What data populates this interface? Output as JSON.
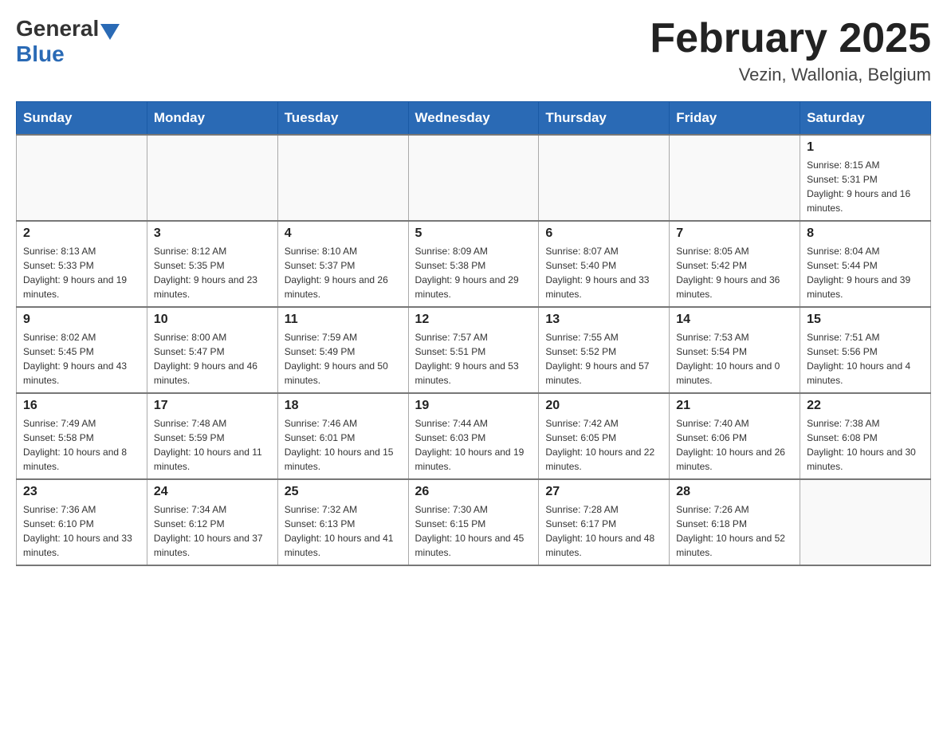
{
  "header": {
    "logo_general": "General",
    "logo_blue": "Blue",
    "month_title": "February 2025",
    "location": "Vezin, Wallonia, Belgium"
  },
  "weekdays": [
    "Sunday",
    "Monday",
    "Tuesday",
    "Wednesday",
    "Thursday",
    "Friday",
    "Saturday"
  ],
  "weeks": [
    [
      {
        "day": "",
        "sunrise": "",
        "sunset": "",
        "daylight": ""
      },
      {
        "day": "",
        "sunrise": "",
        "sunset": "",
        "daylight": ""
      },
      {
        "day": "",
        "sunrise": "",
        "sunset": "",
        "daylight": ""
      },
      {
        "day": "",
        "sunrise": "",
        "sunset": "",
        "daylight": ""
      },
      {
        "day": "",
        "sunrise": "",
        "sunset": "",
        "daylight": ""
      },
      {
        "day": "",
        "sunrise": "",
        "sunset": "",
        "daylight": ""
      },
      {
        "day": "1",
        "sunrise": "Sunrise: 8:15 AM",
        "sunset": "Sunset: 5:31 PM",
        "daylight": "Daylight: 9 hours and 16 minutes."
      }
    ],
    [
      {
        "day": "2",
        "sunrise": "Sunrise: 8:13 AM",
        "sunset": "Sunset: 5:33 PM",
        "daylight": "Daylight: 9 hours and 19 minutes."
      },
      {
        "day": "3",
        "sunrise": "Sunrise: 8:12 AM",
        "sunset": "Sunset: 5:35 PM",
        "daylight": "Daylight: 9 hours and 23 minutes."
      },
      {
        "day": "4",
        "sunrise": "Sunrise: 8:10 AM",
        "sunset": "Sunset: 5:37 PM",
        "daylight": "Daylight: 9 hours and 26 minutes."
      },
      {
        "day": "5",
        "sunrise": "Sunrise: 8:09 AM",
        "sunset": "Sunset: 5:38 PM",
        "daylight": "Daylight: 9 hours and 29 minutes."
      },
      {
        "day": "6",
        "sunrise": "Sunrise: 8:07 AM",
        "sunset": "Sunset: 5:40 PM",
        "daylight": "Daylight: 9 hours and 33 minutes."
      },
      {
        "day": "7",
        "sunrise": "Sunrise: 8:05 AM",
        "sunset": "Sunset: 5:42 PM",
        "daylight": "Daylight: 9 hours and 36 minutes."
      },
      {
        "day": "8",
        "sunrise": "Sunrise: 8:04 AM",
        "sunset": "Sunset: 5:44 PM",
        "daylight": "Daylight: 9 hours and 39 minutes."
      }
    ],
    [
      {
        "day": "9",
        "sunrise": "Sunrise: 8:02 AM",
        "sunset": "Sunset: 5:45 PM",
        "daylight": "Daylight: 9 hours and 43 minutes."
      },
      {
        "day": "10",
        "sunrise": "Sunrise: 8:00 AM",
        "sunset": "Sunset: 5:47 PM",
        "daylight": "Daylight: 9 hours and 46 minutes."
      },
      {
        "day": "11",
        "sunrise": "Sunrise: 7:59 AM",
        "sunset": "Sunset: 5:49 PM",
        "daylight": "Daylight: 9 hours and 50 minutes."
      },
      {
        "day": "12",
        "sunrise": "Sunrise: 7:57 AM",
        "sunset": "Sunset: 5:51 PM",
        "daylight": "Daylight: 9 hours and 53 minutes."
      },
      {
        "day": "13",
        "sunrise": "Sunrise: 7:55 AM",
        "sunset": "Sunset: 5:52 PM",
        "daylight": "Daylight: 9 hours and 57 minutes."
      },
      {
        "day": "14",
        "sunrise": "Sunrise: 7:53 AM",
        "sunset": "Sunset: 5:54 PM",
        "daylight": "Daylight: 10 hours and 0 minutes."
      },
      {
        "day": "15",
        "sunrise": "Sunrise: 7:51 AM",
        "sunset": "Sunset: 5:56 PM",
        "daylight": "Daylight: 10 hours and 4 minutes."
      }
    ],
    [
      {
        "day": "16",
        "sunrise": "Sunrise: 7:49 AM",
        "sunset": "Sunset: 5:58 PM",
        "daylight": "Daylight: 10 hours and 8 minutes."
      },
      {
        "day": "17",
        "sunrise": "Sunrise: 7:48 AM",
        "sunset": "Sunset: 5:59 PM",
        "daylight": "Daylight: 10 hours and 11 minutes."
      },
      {
        "day": "18",
        "sunrise": "Sunrise: 7:46 AM",
        "sunset": "Sunset: 6:01 PM",
        "daylight": "Daylight: 10 hours and 15 minutes."
      },
      {
        "day": "19",
        "sunrise": "Sunrise: 7:44 AM",
        "sunset": "Sunset: 6:03 PM",
        "daylight": "Daylight: 10 hours and 19 minutes."
      },
      {
        "day": "20",
        "sunrise": "Sunrise: 7:42 AM",
        "sunset": "Sunset: 6:05 PM",
        "daylight": "Daylight: 10 hours and 22 minutes."
      },
      {
        "day": "21",
        "sunrise": "Sunrise: 7:40 AM",
        "sunset": "Sunset: 6:06 PM",
        "daylight": "Daylight: 10 hours and 26 minutes."
      },
      {
        "day": "22",
        "sunrise": "Sunrise: 7:38 AM",
        "sunset": "Sunset: 6:08 PM",
        "daylight": "Daylight: 10 hours and 30 minutes."
      }
    ],
    [
      {
        "day": "23",
        "sunrise": "Sunrise: 7:36 AM",
        "sunset": "Sunset: 6:10 PM",
        "daylight": "Daylight: 10 hours and 33 minutes."
      },
      {
        "day": "24",
        "sunrise": "Sunrise: 7:34 AM",
        "sunset": "Sunset: 6:12 PM",
        "daylight": "Daylight: 10 hours and 37 minutes."
      },
      {
        "day": "25",
        "sunrise": "Sunrise: 7:32 AM",
        "sunset": "Sunset: 6:13 PM",
        "daylight": "Daylight: 10 hours and 41 minutes."
      },
      {
        "day": "26",
        "sunrise": "Sunrise: 7:30 AM",
        "sunset": "Sunset: 6:15 PM",
        "daylight": "Daylight: 10 hours and 45 minutes."
      },
      {
        "day": "27",
        "sunrise": "Sunrise: 7:28 AM",
        "sunset": "Sunset: 6:17 PM",
        "daylight": "Daylight: 10 hours and 48 minutes."
      },
      {
        "day": "28",
        "sunrise": "Sunrise: 7:26 AM",
        "sunset": "Sunset: 6:18 PM",
        "daylight": "Daylight: 10 hours and 52 minutes."
      },
      {
        "day": "",
        "sunrise": "",
        "sunset": "",
        "daylight": ""
      }
    ]
  ]
}
